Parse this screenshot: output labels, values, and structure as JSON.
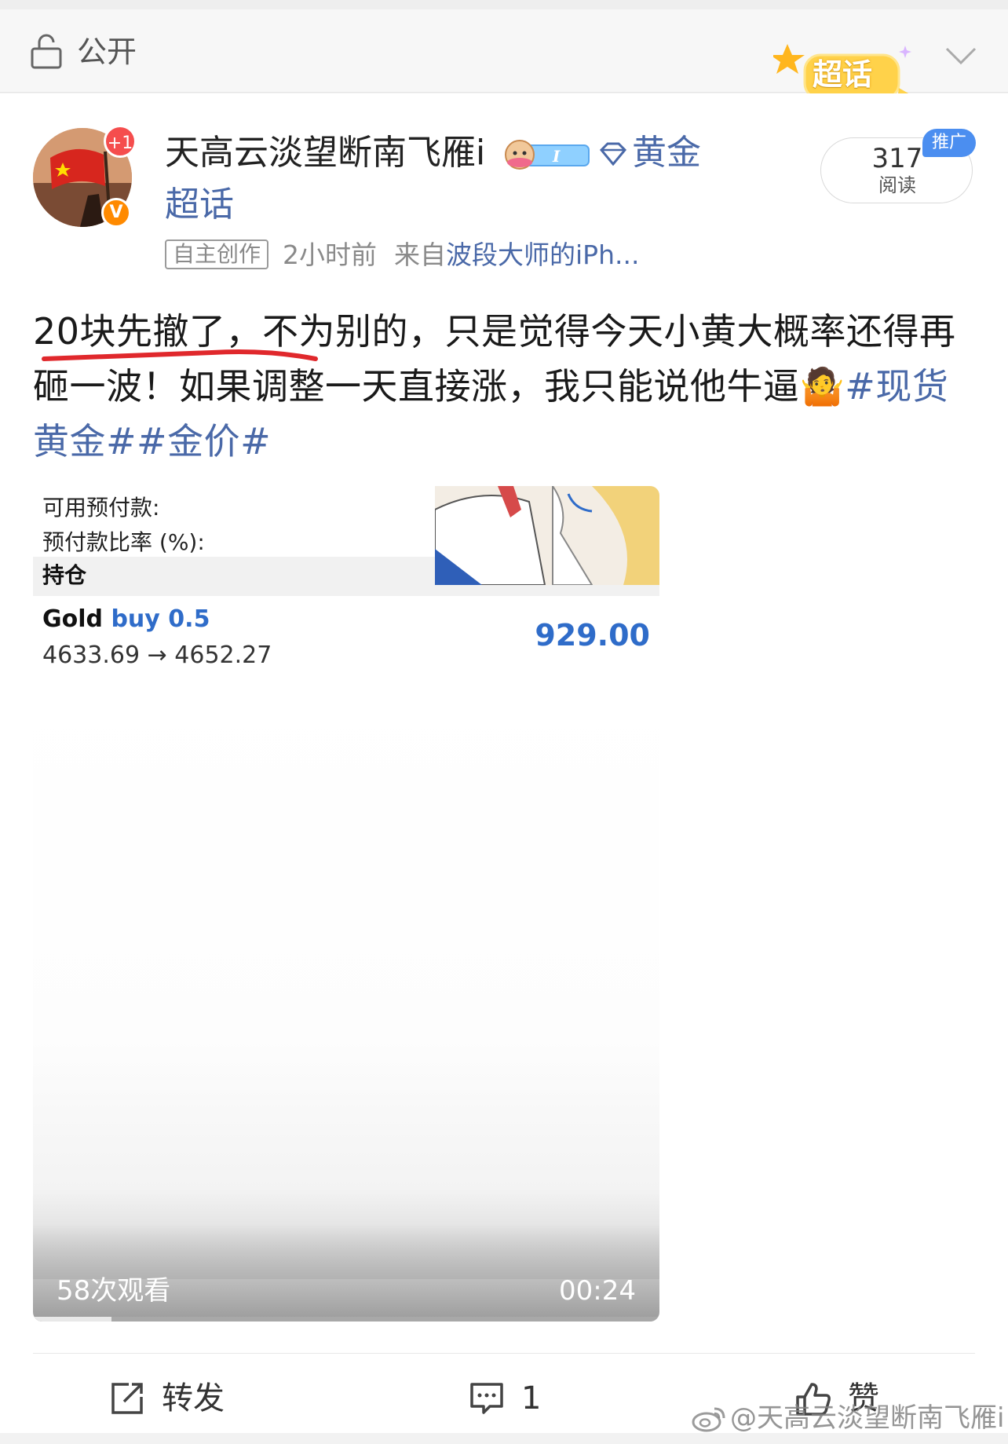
{
  "header": {
    "visibility_label": "公开",
    "chaohua_badge": "超话"
  },
  "post": {
    "author": {
      "name": "天高云淡望断南飞雁i",
      "notification_count": "+1",
      "verified_mark": "V",
      "level_label": "黄金",
      "chaohua_label": "超话"
    },
    "meta": {
      "tag": "自主创作",
      "time": "2小时前",
      "source_prefix": "来自",
      "source": "波段大师的iPh..."
    },
    "reads": {
      "count": "317",
      "label": "阅读",
      "promo": "推广"
    },
    "text": {
      "body": "20块先撤了，不为别的，只是觉得今天小黄大概率还得再砸一波！如果调整一天直接涨，我只能说他牛逼",
      "emoji": "🤷",
      "tags": [
        "#现货黄金#",
        "#金价#"
      ]
    },
    "video": {
      "row1": "可用预付款:",
      "row2": "预付款比率 (%):",
      "holdings_label": "持仓",
      "symbol": "Gold",
      "side": "buy",
      "volume": "0.5",
      "price_open": "4633.69",
      "arrow": "→",
      "price_current": "4652.27",
      "profit": "929.00",
      "views": "58次观看",
      "duration": "00:24",
      "progress_fraction": 0.125
    },
    "actions": {
      "repost": "转发",
      "comment_count": "1",
      "like": "赞"
    }
  },
  "watermark": "@天高云淡望断南飞雁i",
  "colors": {
    "link_blue": "#4a69a8",
    "promo_blue": "#4b8ef0",
    "notif_red": "#f54d4d",
    "verified_orange": "#ff8a00",
    "profit_blue": "#2f6cc9"
  }
}
